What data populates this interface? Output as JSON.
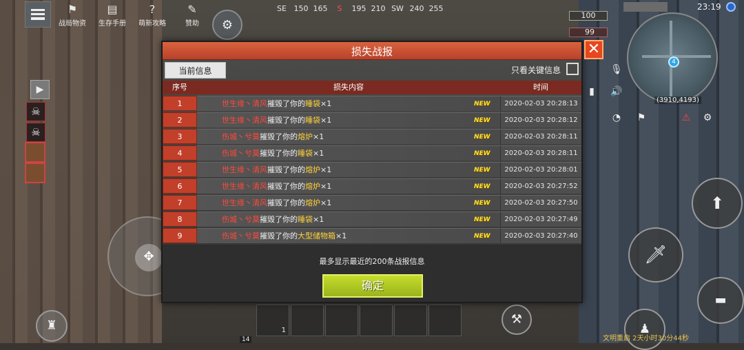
{
  "hud": {
    "menu": [
      {
        "label": "战局物资",
        "icon": "supplies-icon",
        "glyph": "⚑"
      },
      {
        "label": "生存手册",
        "icon": "book-icon",
        "glyph": "▤"
      },
      {
        "label": "萌新攻略",
        "icon": "help-icon",
        "glyph": "?"
      },
      {
        "label": "赞助",
        "icon": "sponsor-icon",
        "glyph": "✎"
      }
    ],
    "compass": [
      "SE",
      "150",
      "165",
      "S",
      "195",
      "210",
      "SW",
      "240",
      "255"
    ],
    "clock": "23:19",
    "health": "100",
    "hunger": "99",
    "coords": "(3910,4193)",
    "map_marker": "4",
    "slot_count": "1",
    "level": "14",
    "bottom_notice": "文明重启 2天小时30分44秒"
  },
  "dialog": {
    "title": "损失战报",
    "tab_current": "当前信息",
    "filter_label": "只看关键信息",
    "filter_checked": false,
    "columns": {
      "index": "序号",
      "content": "损失内容",
      "time": "时间"
    },
    "new_tag": "NEW",
    "rows": [
      {
        "index": "1",
        "attacker": "世生缘丶清风",
        "verb": "摧毁了你的",
        "item": "睡袋",
        "qty": "×1",
        "time": "2020-02-03 20:28:13"
      },
      {
        "index": "2",
        "attacker": "世生缘丶清风",
        "verb": "摧毁了你的",
        "item": "睡袋",
        "qty": "×1",
        "time": "2020-02-03 20:28:12"
      },
      {
        "index": "3",
        "attacker": "伤城丶兮莫",
        "verb": "摧毁了你的",
        "item": "熔炉",
        "qty": "×1",
        "time": "2020-02-03 20:28:11"
      },
      {
        "index": "4",
        "attacker": "伤城丶兮莫",
        "verb": "摧毁了你的",
        "item": "睡袋",
        "qty": "×1",
        "time": "2020-02-03 20:28:11"
      },
      {
        "index": "5",
        "attacker": "世生缘丶清风",
        "verb": "摧毁了你的",
        "item": "熔炉",
        "qty": "×1",
        "time": "2020-02-03 20:28:01"
      },
      {
        "index": "6",
        "attacker": "世生缘丶清风",
        "verb": "摧毁了你的",
        "item": "熔炉",
        "qty": "×1",
        "time": "2020-02-03 20:27:52"
      },
      {
        "index": "7",
        "attacker": "世生缘丶清风",
        "verb": "摧毁了你的",
        "item": "熔炉",
        "qty": "×1",
        "time": "2020-02-03 20:27:50"
      },
      {
        "index": "8",
        "attacker": "伤城丶兮莫",
        "verb": "摧毁了你的",
        "item": "睡袋",
        "qty": "×1",
        "time": "2020-02-03 20:27:49"
      },
      {
        "index": "9",
        "attacker": "伤城丶兮莫",
        "verb": "摧毁了你的",
        "item": "大型储物箱",
        "qty": "×1",
        "time": "2020-02-03 20:27:40"
      }
    ],
    "footer_note": "最多显示最近的200条战报信息",
    "confirm_label": "确定"
  }
}
